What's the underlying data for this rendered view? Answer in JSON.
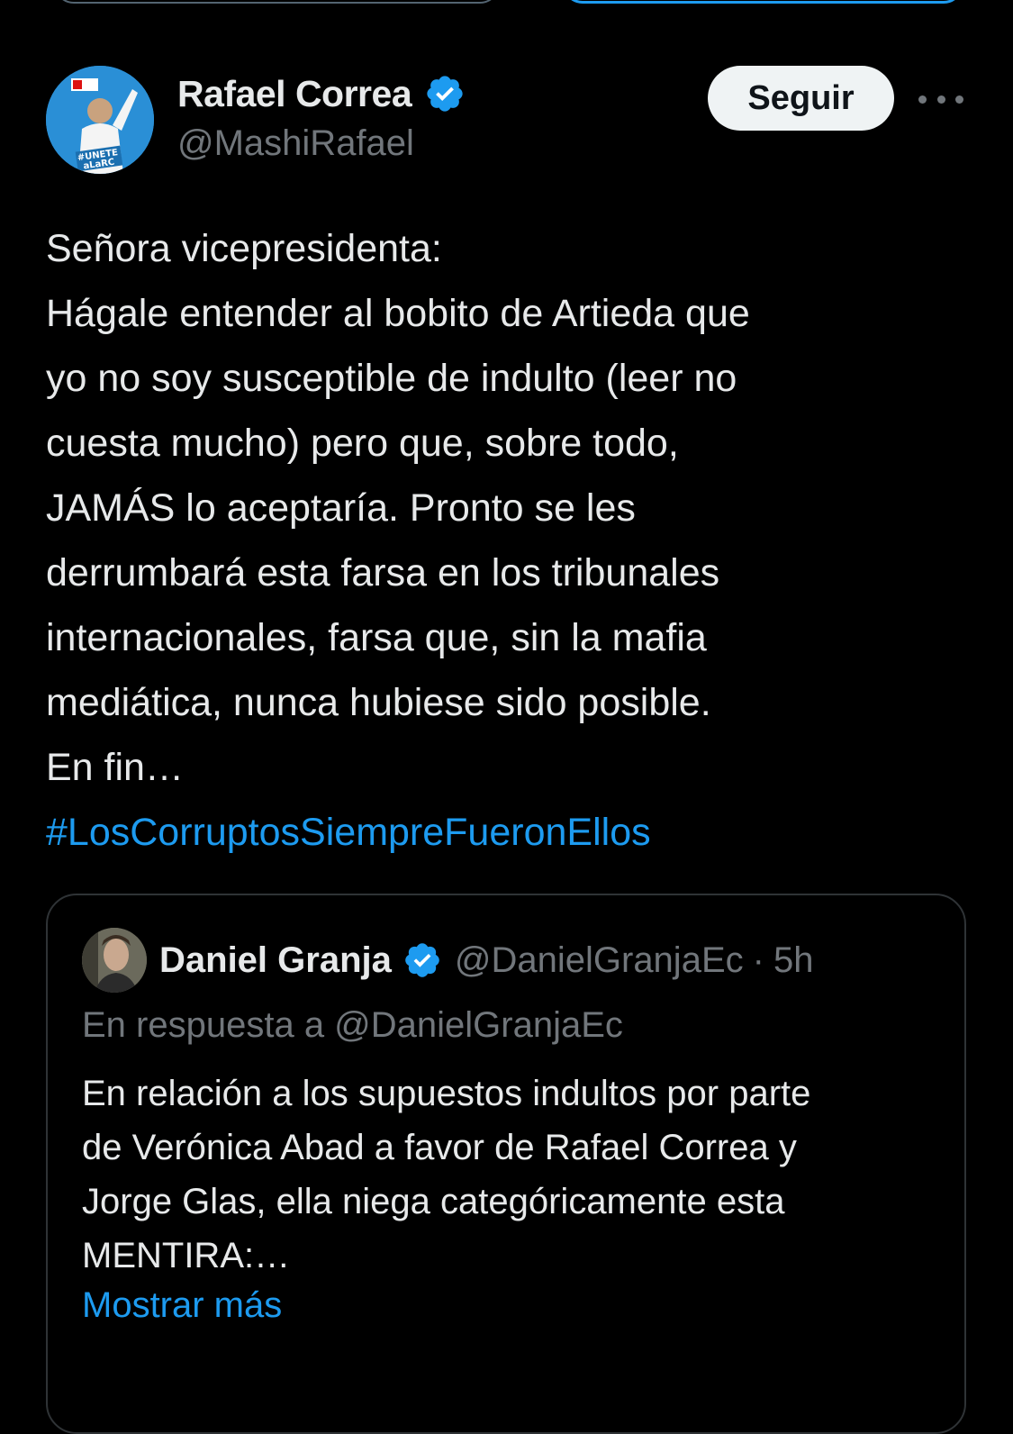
{
  "tweet": {
    "author_name": "Rafael Correa",
    "author_handle": "@MashiRafael",
    "follow_label": "Seguir",
    "avatar_text": "#UNETE aLaRC",
    "lines": [
      "Señora vicepresidenta:",
      "Hágale entender al bobito de Artieda que",
      "yo no soy susceptible de indulto (leer no",
      "cuesta mucho) pero que, sobre todo,",
      "JAMÁS lo aceptaría. Pronto se les",
      "derrumbará esta farsa en los tribunales",
      "internacionales, farsa que, sin la mafia",
      "mediática, nunca hubiese sido posible.",
      "En fin…"
    ],
    "hashtag": "#LosCorruptosSiempreFueronEllos"
  },
  "quote": {
    "author_name": "Daniel Granja",
    "author_handle": "@DanielGranjaEc",
    "separator": "·",
    "time": "5h",
    "reply_to": "En respuesta a @DanielGranjaEc",
    "lines": [
      "En relación a los supuestos indultos por parte",
      "de Verónica Abad a favor de Rafael Correa y",
      "Jorge Glas, ella niega categóricamente esta",
      "MENTIRA:…"
    ],
    "show_more": "Mostrar más"
  },
  "colors": {
    "background": "#000000",
    "text": "#e7e9ea",
    "secondary": "#71767b",
    "link": "#1d9bf0",
    "verified": "#1d9bf0"
  },
  "icons": [
    "verified-badge-icon",
    "more-options-icon"
  ]
}
